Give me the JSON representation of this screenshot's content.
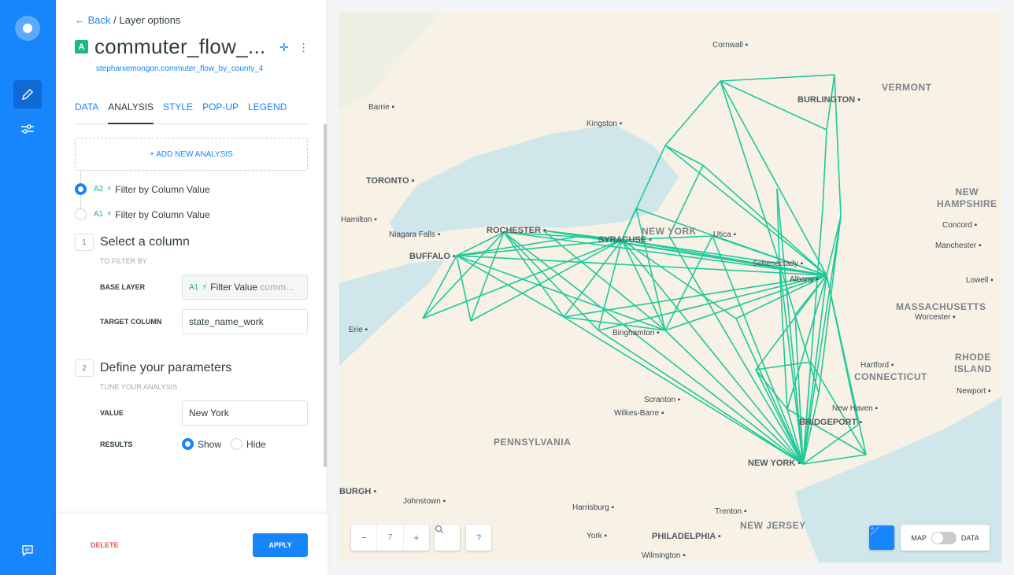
{
  "rail": {
    "icons": [
      "carto-logo-icon",
      "edit-pencil-icon",
      "sliders-icon",
      "chat-icon"
    ]
  },
  "panel": {
    "breadcrumb": {
      "back": "Back",
      "current": "/ Layer options"
    },
    "layer_badge": "A",
    "layer_title": "commuter_flow_...",
    "layer_source": "stephaniemongon.commuter_flow_by_county_4",
    "tabs": [
      {
        "label": "DATA"
      },
      {
        "label": "ANALYSIS",
        "active": true
      },
      {
        "label": "STYLE"
      },
      {
        "label": "POP-UP"
      },
      {
        "label": "LEGEND"
      }
    ],
    "add_analysis": "+ ADD NEW ANALYSIS",
    "nodes": [
      {
        "id": "A2",
        "label": "Filter by Column Value",
        "selected": true
      },
      {
        "id": "A1",
        "label": "Filter by Column Value",
        "selected": false
      }
    ],
    "step1": {
      "num": "1",
      "title": "Select a column",
      "hint": "TO FILTER BY",
      "base_layer_label": "BASE LAYER",
      "base_layer_id": "A1",
      "base_layer_value": "Filter Value",
      "base_layer_extra": "comm...",
      "target_label": "TARGET COLUMN",
      "target_value": "state_name_work"
    },
    "step2": {
      "num": "2",
      "title": "Define your parameters",
      "hint": "TUNE YOUR ANALYSIS",
      "value_label": "VALUE",
      "value": "New York",
      "results_label": "RESULTS",
      "show": "Show",
      "hide": "Hide",
      "results_selected": "Show"
    },
    "delete": "DELETE",
    "apply": "APPLY"
  },
  "map": {
    "flow_color": "#1ec99a",
    "zoom_level": "7",
    "zoom_out": "−",
    "zoom_in": "+",
    "search_icon": "search-icon",
    "help": "?",
    "toggle": {
      "map": "MAP",
      "data": "DATA",
      "selected": "MAP"
    },
    "cities": [
      "Cornwall",
      "Barrie",
      "Kingston",
      "BURLINGTON",
      "TORONTO",
      "Hamilton",
      "Niagara Falls",
      "ROCHESTER",
      "SYRACUSE",
      "Utica",
      "BUFFALO",
      "Schenectady",
      "Albany",
      "Erie",
      "Binghamton",
      "Concord",
      "Manchester",
      "Lowell",
      "Worcester",
      "Hartford",
      "New Haven",
      "BRIDGEPORT",
      "Newport",
      "Scranton",
      "Wilkes-Barre",
      "NEW YORK",
      "Johnstown",
      "Harrisburg",
      "Trenton",
      "York",
      "PHILADELPHIA",
      "Wilmington",
      "BURGH"
    ],
    "states": [
      "VERMONT",
      "NEW YORK",
      "NEW HAMPSHIRE",
      "MASSACHUSETTS",
      "RHODE ISLAND",
      "CONNECTICUT",
      "PENNSYLVANIA",
      "NEW JERSEY"
    ]
  }
}
